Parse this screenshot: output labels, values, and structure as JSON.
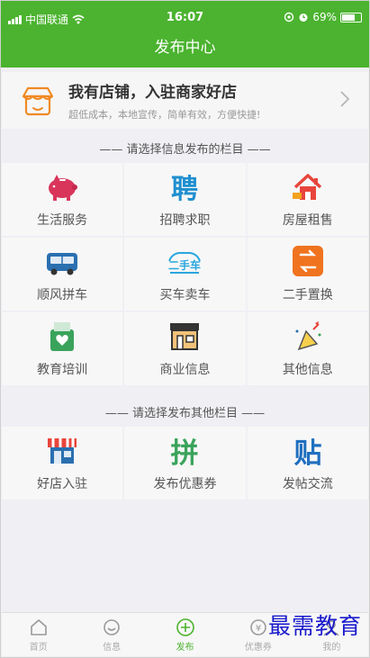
{
  "status": {
    "carrier": "中国联通",
    "time": "16:07",
    "battery": "69%",
    "battery_level": 0.69
  },
  "header": {
    "title": "发布中心"
  },
  "merchant": {
    "title": "我有店铺，入驻商家好店",
    "subtitle": "超低成本，本地宣传，简单有效，方便快捷!",
    "icon": "shop-icon"
  },
  "section1": {
    "title": "—— 请选择信息发布的栏目 ——",
    "items": [
      {
        "label": "生活服务",
        "icon": "piggy-bank-icon"
      },
      {
        "label": "招聘求职",
        "icon": "recruit-icon"
      },
      {
        "label": "房屋租售",
        "icon": "house-icon"
      },
      {
        "label": "顺风拼车",
        "icon": "bus-icon"
      },
      {
        "label": "买车卖车",
        "icon": "car-icon",
        "glyph": "二手车"
      },
      {
        "label": "二手置换",
        "icon": "swap-icon"
      },
      {
        "label": "教育培训",
        "icon": "education-bag-icon"
      },
      {
        "label": "商业信息",
        "icon": "storefront-icon"
      },
      {
        "label": "其他信息",
        "icon": "party-icon"
      }
    ]
  },
  "section2": {
    "title": "—— 请选择发布其他栏目 ——",
    "items": [
      {
        "label": "好店入驻",
        "icon": "awning-shop-icon"
      },
      {
        "label": "发布优惠券",
        "icon": "group-buy-icon",
        "glyph": "拼"
      },
      {
        "label": "发帖交流",
        "icon": "post-icon",
        "glyph": "贴"
      }
    ]
  },
  "tabbar": {
    "items": [
      {
        "label": "首页",
        "icon": "home-icon"
      },
      {
        "label": "信息",
        "icon": "smile-icon"
      },
      {
        "label": "发布",
        "icon": "plus-circle-icon",
        "active": true
      },
      {
        "label": "优惠券",
        "icon": "coupon-icon"
      },
      {
        "label": "我的",
        "icon": "user-icon"
      }
    ]
  },
  "watermark": "最需教育",
  "colors": {
    "brand": "#4bb32f",
    "background": "#efeff4"
  }
}
